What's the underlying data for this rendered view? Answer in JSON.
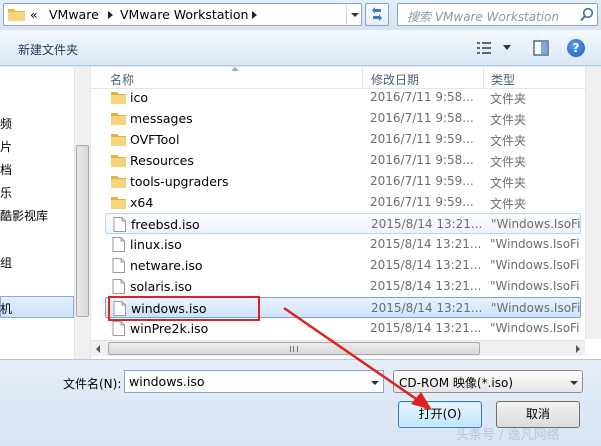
{
  "address_bar": {
    "crumbs": [
      "«",
      "VMware",
      "VMware Workstation"
    ],
    "search_placeholder": "搜索 VMware Workstation"
  },
  "toolbar": {
    "new_folder_label": "新建文件夹"
  },
  "nav_pane": {
    "items": [
      "频",
      "片",
      "档",
      "乐",
      "酷影视库",
      "组",
      "机"
    ]
  },
  "file_list": {
    "headers": {
      "name": "名称",
      "date": "修改日期",
      "type": "类型"
    },
    "rows": [
      {
        "name": "ico",
        "date": "2016/7/11 9:58...",
        "type": "文件夹",
        "kind": "folder"
      },
      {
        "name": "messages",
        "date": "2016/7/11 9:58...",
        "type": "文件夹",
        "kind": "folder"
      },
      {
        "name": "OVFTool",
        "date": "2016/7/11 9:59...",
        "type": "文件夹",
        "kind": "folder"
      },
      {
        "name": "Resources",
        "date": "2016/7/11 9:58...",
        "type": "文件夹",
        "kind": "folder"
      },
      {
        "name": "tools-upgraders",
        "date": "2016/7/11 9:59...",
        "type": "文件夹",
        "kind": "folder"
      },
      {
        "name": "x64",
        "date": "2016/7/11 9:59...",
        "type": "文件夹",
        "kind": "folder"
      },
      {
        "name": "freebsd.iso",
        "date": "2015/8/14 13:21...",
        "type": "\"Windows.IsoFil",
        "kind": "file"
      },
      {
        "name": "linux.iso",
        "date": "2015/8/14 13:21...",
        "type": "\"Windows.IsoFil",
        "kind": "file"
      },
      {
        "name": "netware.iso",
        "date": "2015/8/14 13:21...",
        "type": "\"Windows.IsoFil",
        "kind": "file"
      },
      {
        "name": "solaris.iso",
        "date": "2015/8/14 13:21...",
        "type": "\"Windows.IsoFil",
        "kind": "file"
      },
      {
        "name": "windows.iso",
        "date": "2015/8/14 13:21...",
        "type": "\"Windows.IsoFil",
        "kind": "file"
      },
      {
        "name": "winPre2k.iso",
        "date": "2015/8/14 13:21...",
        "type": "\"Windows.IsoFil",
        "kind": "file"
      }
    ]
  },
  "bottom": {
    "filename_label": "文件名(N):",
    "filename_value": "windows.iso",
    "filetype_value": "CD-ROM 映像(*.iso)",
    "open_label": "打开(O)",
    "cancel_label": "取消"
  },
  "watermark": "头条号 / 逸凡网络",
  "colors": {
    "highlight": "#e02121",
    "selected_bg": "#cde3fc"
  }
}
